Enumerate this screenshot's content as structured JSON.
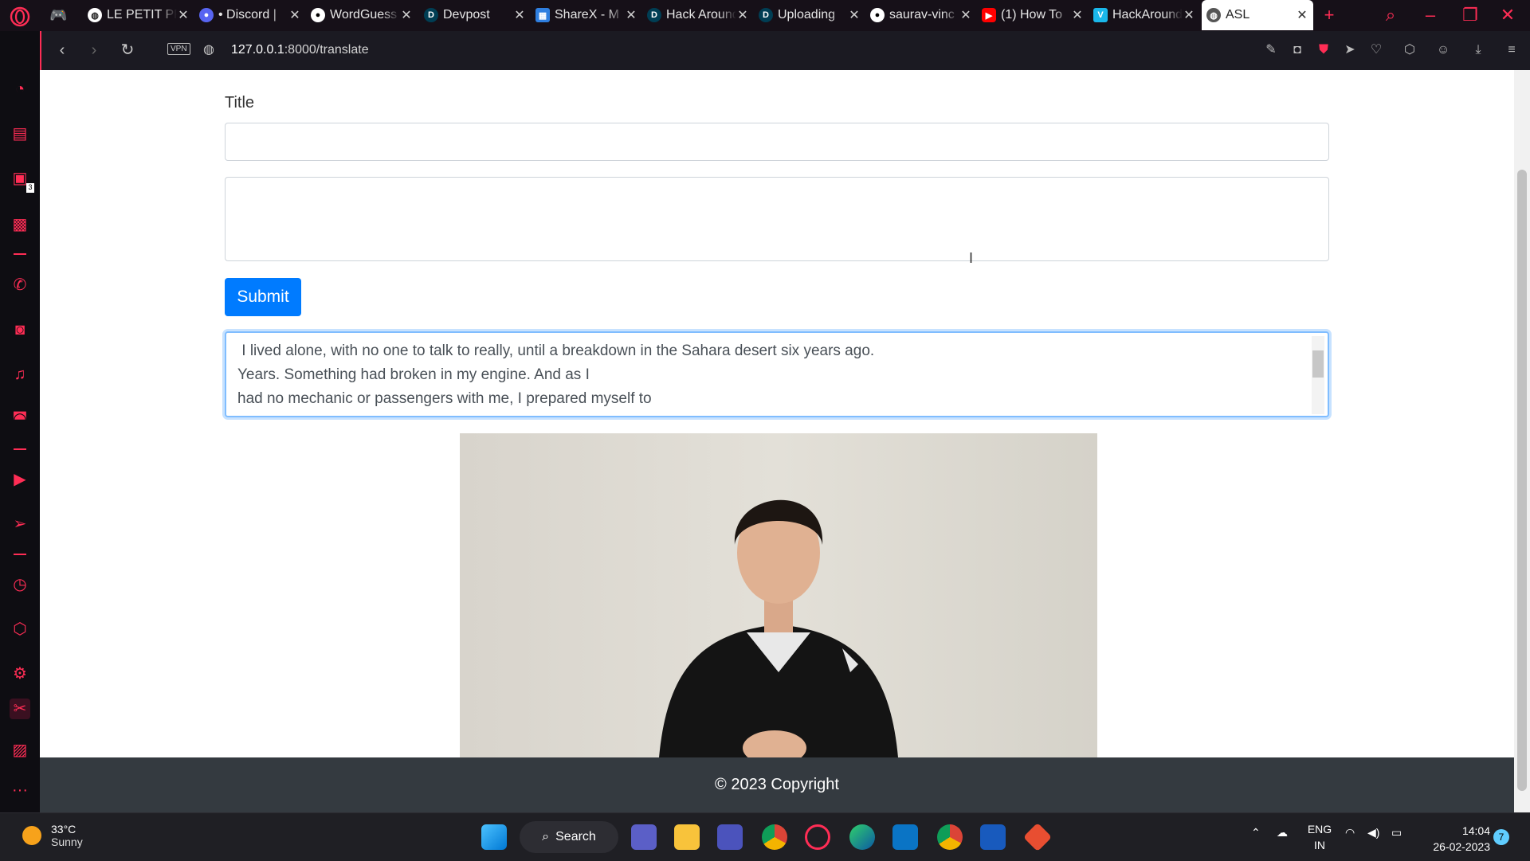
{
  "tabs": [
    {
      "title": "LE PETIT PRINCE",
      "favicon": "globe-icon",
      "color": "#ffffff"
    },
    {
      "title": "• Discord | ",
      "favicon": "discord-icon",
      "color": "#5865f2"
    },
    {
      "title": "WordGuess",
      "favicon": "github-icon",
      "color": "#ffffff"
    },
    {
      "title": "Devpost",
      "favicon": "devpost-icon",
      "color": "#003e54"
    },
    {
      "title": "ShareX - M",
      "favicon": "sharex-icon",
      "color": "#2f7fe0"
    },
    {
      "title": "Hack Around",
      "favicon": "devpost-icon",
      "color": "#003e54"
    },
    {
      "title": "Uploading",
      "favicon": "devpost-icon",
      "color": "#003e54"
    },
    {
      "title": "saurav-vinc",
      "favicon": "github-icon",
      "color": "#ffffff"
    },
    {
      "title": "(1) How To",
      "favicon": "youtube-icon",
      "color": "#ff0000"
    },
    {
      "title": "HackAround",
      "favicon": "vimeo-icon",
      "color": "#1ab7ea"
    },
    {
      "title": "ASL",
      "favicon": "globe-icon",
      "color": "#ffffff",
      "active": true
    }
  ],
  "address": {
    "vpn_label": "VPN",
    "url_host": "127.0.0.1",
    "url_path": ":8000/translate"
  },
  "form": {
    "title_label": "Title",
    "title_value": "",
    "body_value": "",
    "submit_label": "Submit"
  },
  "output": {
    "lines": [
      " I lived alone, with no one to talk to really, until a breakdown in the Sahara desert six years ago.",
      "Years. Something had broken in my engine. And as I",
      "had no mechanic or passengers with me, I prepared myself to"
    ]
  },
  "footer": {
    "text": "© 2023 Copyright"
  },
  "taskbar": {
    "weather_temp": "33°C",
    "weather_desc": "Sunny",
    "search_label": "Search",
    "lang_line1": "ENG",
    "lang_line2": "IN",
    "time": "14:04",
    "date": "26-02-2023",
    "notifications": "7"
  },
  "colors": {
    "accent": "#ff2d55",
    "submit_bg": "#007bff",
    "footer_bg": "#343a40"
  }
}
